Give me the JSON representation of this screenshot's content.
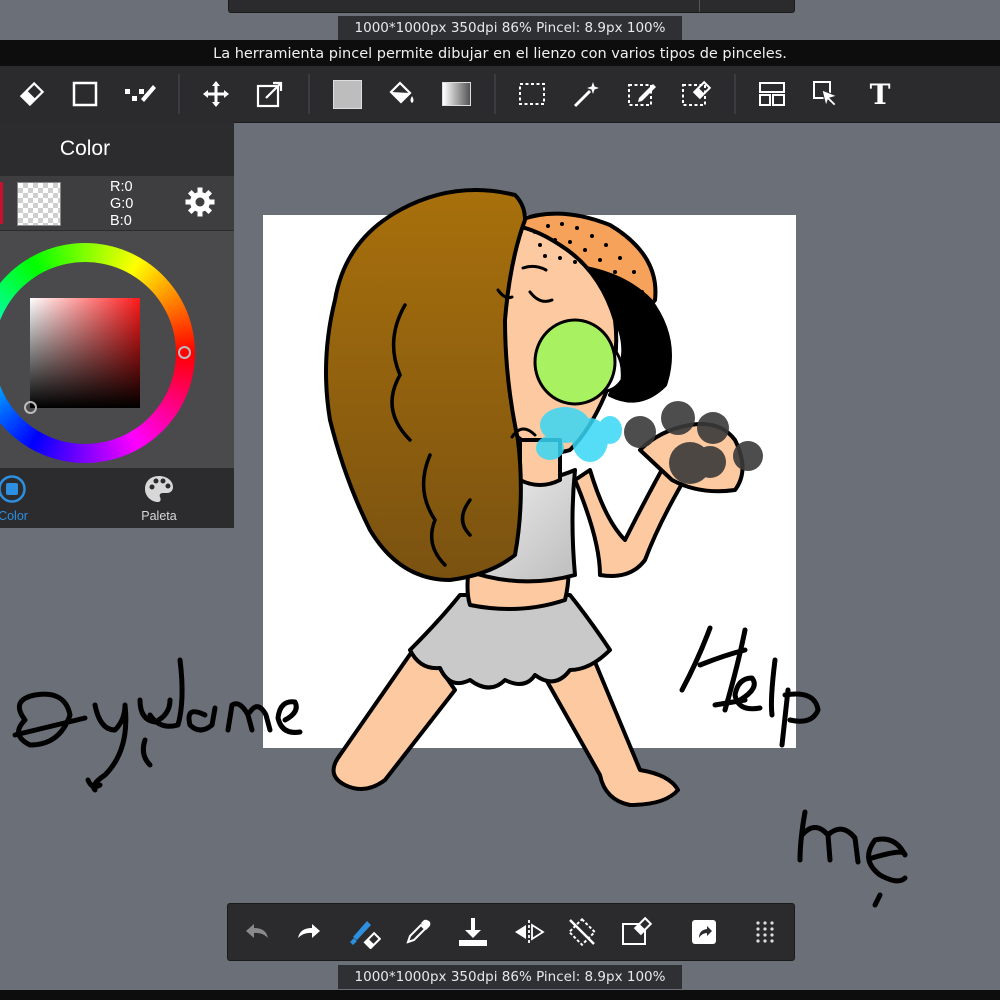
{
  "status_top": "1000*1000px 350dpi 86% Pincel: 8.9px 100%",
  "status_bottom": "1000*1000px 350dpi 86% Pincel: 8.9px 100%",
  "tip": "La herramienta pincel permite dibujar en el lienzo con varios tipos de pinceles.",
  "toolbar": {
    "icons": [
      "eraser-icon",
      "rectangle-icon",
      "snap-icon",
      "move-icon",
      "transform-icon",
      "fill-color-icon",
      "bucket-icon",
      "gradient-icon",
      "select-rect-icon",
      "magic-wand-icon",
      "select-pen-icon",
      "select-eraser-icon",
      "layer-panel-icon",
      "select-arrow-icon",
      "text-icon"
    ],
    "text_tool": "T"
  },
  "color_panel": {
    "title": "Color",
    "r": "R:0",
    "g": "G:0",
    "b": "B:0",
    "tabs": [
      {
        "label": "Color",
        "active": true
      },
      {
        "label": "Paleta",
        "active": false
      }
    ],
    "active_color": "#2d8fe0"
  },
  "canvas": {
    "handwriting": [
      "Ayudame",
      "Help",
      "me"
    ]
  },
  "bottom_toolbar": {
    "icons": [
      "undo-icon",
      "redo-icon",
      "brush-eraser-icon",
      "eyedropper-icon",
      "save-icon",
      "flip-icon",
      "rotate-reset-icon",
      "clear-icon",
      "share-icon",
      "menu-dots-icon"
    ]
  },
  "colors": {
    "bg": "#6b6f77",
    "bar": "#2b2b2e",
    "hair": "#a66e10",
    "skin": "#fdc9a0",
    "accent_blue": "#2d8fe0"
  }
}
